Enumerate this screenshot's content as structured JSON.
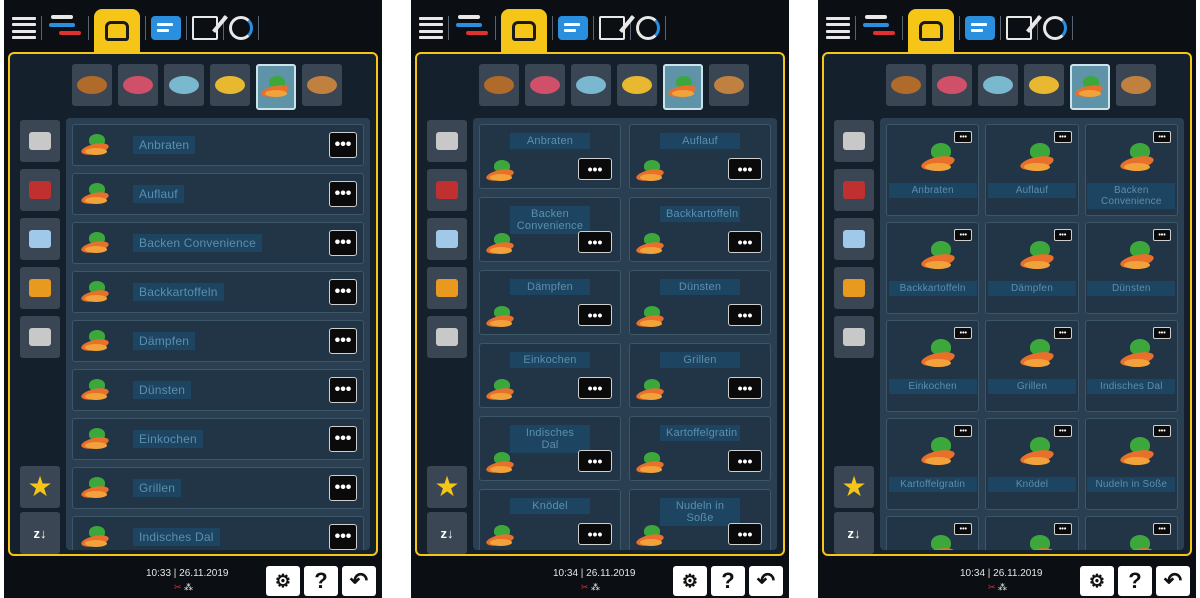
{
  "colors": {
    "accent": "#f5c518",
    "background": "#0b0e12",
    "frame": "#14202c",
    "content": "#2b3f52",
    "label_highlight": "#1d4460",
    "blue": "#2b8fe0"
  },
  "topbar": {
    "icons": [
      "menu-icon",
      "logo-icon",
      "chef-hat-icon",
      "notes-icon",
      "edit-icon",
      "cycle-icon"
    ]
  },
  "categories": [
    "poultry",
    "meat",
    "fish",
    "egg-dishes",
    "vegetables",
    "bakery"
  ],
  "active_category": "vegetables",
  "sidebar": [
    "oven-rack-icon",
    "pan-icon",
    "pot-icon",
    "toaster-icon",
    "grill-icon"
  ],
  "panels": [
    {
      "view": "list",
      "items": [
        "Anbraten",
        "Auflauf",
        "Backen Convenience",
        "Backkartoffeln",
        "Dämpfen",
        "Dünsten",
        "Einkochen",
        "Grillen",
        "Indisches Dal"
      ],
      "time": "10:33 | 26.11.2019"
    },
    {
      "view": "grid2",
      "items": [
        "Anbraten",
        "Auflauf",
        "Backen Convenience",
        "Backkartoffeln",
        "Dämpfen",
        "Dünsten",
        "Einkochen",
        "Grillen",
        "Indisches Dal",
        "Kartoffelgratin",
        "Knödel",
        "Nudeln in Soße"
      ],
      "time": "10:34 | 26.11.2019"
    },
    {
      "view": "grid3",
      "items": [
        "Anbraten",
        "Auflauf",
        "Backen Convenience",
        "Backkartoffeln",
        "Dämpfen",
        "Dünsten",
        "Einkochen",
        "Grillen",
        "Indisches Dal",
        "Kartoffelgratin",
        "Knödel",
        "Nudeln in Soße",
        "",
        "",
        ""
      ],
      "time": "10:34 | 26.11.2019"
    }
  ],
  "more_button": "•••",
  "help_label": "?",
  "sort_label": "z↓",
  "star": "★"
}
